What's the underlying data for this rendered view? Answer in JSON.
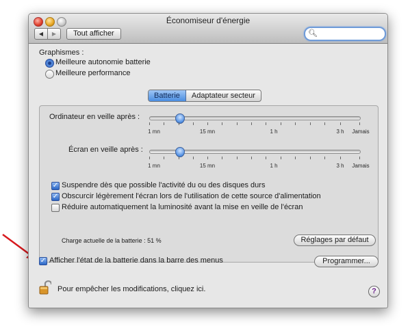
{
  "window": {
    "title": "Économiseur d'énergie"
  },
  "toolbar": {
    "back_label": "◀",
    "forward_label": "▶",
    "show_all_label": "Tout afficher",
    "search_value": ""
  },
  "graphics": {
    "label": "Graphismes :",
    "options": [
      {
        "label": "Meilleure autonomie batterie",
        "selected": true
      },
      {
        "label": "Meilleure performance",
        "selected": false
      }
    ]
  },
  "tabs": [
    {
      "label": "Batterie",
      "selected": true
    },
    {
      "label": "Adaptateur secteur",
      "selected": false
    }
  ],
  "sliders": {
    "computer_sleep": {
      "label": "Ordinateur en veille après :",
      "value": "10 mn"
    },
    "display_sleep": {
      "label": "Écran en veille après :",
      "value": "10 mn"
    },
    "tick_labels": [
      "1 mn",
      "15 mn",
      "1 h",
      "3 h",
      "Jamais"
    ]
  },
  "options": [
    {
      "label": "Suspendre dès que possible l'activité du ou des disques durs",
      "checked": true
    },
    {
      "label": "Obscurcir légèrement l'écran lors de l'utilisation de cette source d'alimentation",
      "checked": true
    },
    {
      "label": "Réduire automatiquement la luminosité avant la mise en veille de l'écran",
      "checked": false
    }
  ],
  "battery": {
    "charge_text": "Charge actuelle de la batterie : 51 %",
    "defaults_button": "Réglages par défaut"
  },
  "menubar_option": {
    "label": "Afficher l'état de la batterie dans la barre des menus",
    "checked": true
  },
  "schedule_button": "Programmer...",
  "lock_text": "Pour empêcher les modifications, cliquez ici.",
  "help_label": "?",
  "colors": {
    "accent": "#4a8de1",
    "annotation_arrow": "#d8191e"
  }
}
